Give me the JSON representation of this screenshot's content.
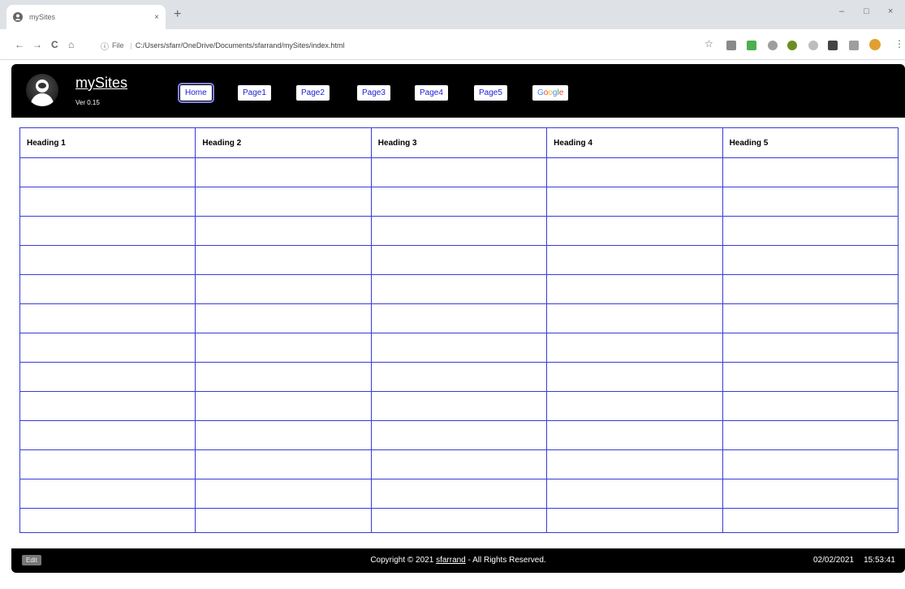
{
  "browser": {
    "tab_title": "mySites",
    "tab_close": "×",
    "new_tab": "+",
    "window_controls": {
      "minimize": "–",
      "maximize": "□",
      "close": "×"
    },
    "nav": {
      "back": "←",
      "forward": "→",
      "reload": "C",
      "home": "⌂"
    },
    "address": {
      "info": "ⓘ",
      "scheme": "File",
      "separator": "|",
      "url": "C:/Users/sfarr/OneDrive/Documents/sfarrand/mySites/index.html"
    },
    "bookmark_star": "☆",
    "menu_dots": "⋮"
  },
  "header": {
    "brand": "mySites",
    "version": "Ver 0.15",
    "nav_links": [
      "Home",
      "Page1",
      "Page2",
      "Page3",
      "Page4",
      "Page5"
    ],
    "google_letters": [
      "G",
      "o",
      "o",
      "g",
      "l",
      "e"
    ]
  },
  "table": {
    "headings": [
      "Heading 1",
      "Heading 2",
      "Heading 3",
      "Heading 4",
      "Heading 5"
    ],
    "rows": [
      [
        "",
        "",
        "",
        "",
        ""
      ],
      [
        "",
        "",
        "",
        "",
        ""
      ],
      [
        "",
        "",
        "",
        "",
        ""
      ],
      [
        "",
        "",
        "",
        "",
        ""
      ],
      [
        "",
        "",
        "",
        "",
        ""
      ],
      [
        "",
        "",
        "",
        "",
        ""
      ],
      [
        "",
        "",
        "",
        "",
        ""
      ],
      [
        "",
        "",
        "",
        "",
        ""
      ],
      [
        "",
        "",
        "",
        "",
        ""
      ],
      [
        "",
        "",
        "",
        "",
        ""
      ],
      [
        "",
        "",
        "",
        "",
        ""
      ],
      [
        "",
        "",
        "",
        "",
        ""
      ],
      [
        "",
        "",
        "",
        "",
        ""
      ]
    ]
  },
  "footer": {
    "edit_label": "Edit",
    "copyright_prefix": "Copyright © 2021 ",
    "copyright_author": "sfarrand",
    "copyright_suffix": " - All Rights Reserved.",
    "date": "02/02/2021",
    "time": "15:53:41"
  },
  "colors": {
    "header_bg": "#000000",
    "link": "#1a1ad6",
    "table_border": "#3a3ad6",
    "google": [
      "#4285f4",
      "#ea4335",
      "#fbbc05",
      "#4285f4",
      "#34a853",
      "#ea4335"
    ]
  }
}
